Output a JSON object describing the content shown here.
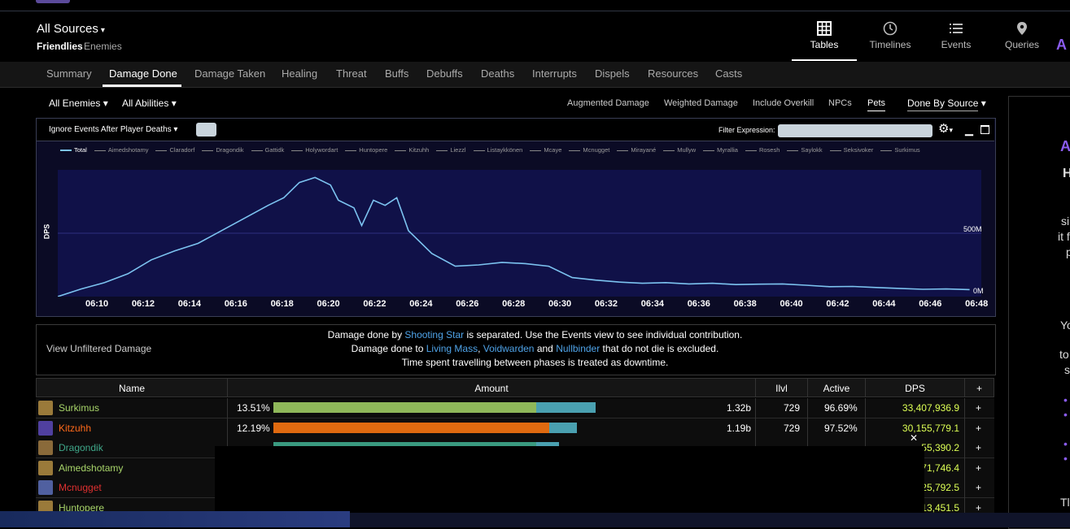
{
  "header": {
    "source_title": "All Sources",
    "friendlies": "Friendlies",
    "enemies": "Enemies",
    "nav": [
      {
        "label": "Tables",
        "icon": "table-icon"
      },
      {
        "label": "Timelines",
        "icon": "clock-icon"
      },
      {
        "label": "Events",
        "icon": "list-icon"
      },
      {
        "label": "Queries",
        "icon": "map-pin-icon"
      }
    ]
  },
  "tabs": [
    "Summary",
    "Damage Done",
    "Damage Taken",
    "Healing",
    "Threat",
    "Buffs",
    "Debuffs",
    "Deaths",
    "Interrupts",
    "Dispels",
    "Resources",
    "Casts"
  ],
  "active_tab": "Damage Done",
  "filters": {
    "enemies": "All Enemies",
    "abilities": "All Abilities",
    "options": [
      "Augmented Damage",
      "Weighted Damage",
      "Include Overkill",
      "NPCs",
      "Pets"
    ],
    "active_option": "Pets",
    "done_by": "Done By Source"
  },
  "graph": {
    "ignore_label": "Ignore Events After Player Deaths",
    "filter_label": "Filter Expression:",
    "legend": [
      "Total",
      "Aimedshotamy",
      "Claradorf",
      "Dragondik",
      "Gattidk",
      "Holywordart",
      "Huntopere",
      "Kitzuhh",
      "Liezzl",
      "Listaykkönen",
      "Mcaye",
      "Mcnugget",
      "Mirayané",
      "Mullyw",
      "Myrallia",
      "Rosesh",
      "Saylokk",
      "Seksivoker",
      "Surkimus"
    ],
    "y_label": "DPS",
    "y_ticks": [
      "500M",
      "0M"
    ],
    "x_ticks": [
      "06:10",
      "06:12",
      "06:14",
      "06:16",
      "06:18",
      "06:20",
      "06:22",
      "06:24",
      "06:26",
      "06:28",
      "06:30",
      "06:32",
      "06:34",
      "06:36",
      "06:38",
      "06:40",
      "06:42",
      "06:44",
      "06:46",
      "06:48"
    ]
  },
  "chart_data": {
    "type": "line",
    "title": "",
    "ylabel": "DPS",
    "ylim": [
      0,
      1000000000
    ],
    "series": [
      {
        "name": "Total",
        "color": "#7cc3f0",
        "x": [
          "06:09:00",
          "06:10:00",
          "06:11:00",
          "06:12:00",
          "06:13:00",
          "06:14:00",
          "06:15:00",
          "06:16:00",
          "06:17:00",
          "06:18:00",
          "06:18:40",
          "06:19:20",
          "06:20:00",
          "06:20:40",
          "06:21:00",
          "06:21:40",
          "06:22:00",
          "06:22:30",
          "06:23:00",
          "06:23:30",
          "06:24:00",
          "06:25:00",
          "06:26:00",
          "06:27:00",
          "06:28:00",
          "06:29:00",
          "06:30:00",
          "06:31:00",
          "06:32:00",
          "06:33:00",
          "06:34:00",
          "06:35:00",
          "06:36:00",
          "06:37:00",
          "06:38:00",
          "06:39:00",
          "06:40:00",
          "06:41:00",
          "06:42:00",
          "06:43:00",
          "06:44:00",
          "06:45:00",
          "06:46:00",
          "06:47:00",
          "06:48:00"
        ],
        "values": [
          0,
          60000000,
          110000000,
          180000000,
          290000000,
          360000000,
          420000000,
          520000000,
          620000000,
          720000000,
          780000000,
          900000000,
          940000000,
          880000000,
          760000000,
          700000000,
          560000000,
          760000000,
          720000000,
          780000000,
          520000000,
          340000000,
          240000000,
          250000000,
          270000000,
          260000000,
          240000000,
          150000000,
          130000000,
          115000000,
          105000000,
          110000000,
          100000000,
          105000000,
          95000000,
          98000000,
          100000000,
          90000000,
          78000000,
          80000000,
          72000000,
          65000000,
          58000000,
          60000000,
          55000000
        ]
      }
    ]
  },
  "notice": {
    "left": "View Unfiltered Damage",
    "line1_a": "Damage done by ",
    "line1_hl": "Shooting Star",
    "line1_b": " is separated. Use the Events view to see individual contribution.",
    "line2_a": "Damage done to ",
    "line2_hl1": "Living Mass",
    "line2_sep1": ", ",
    "line2_hl2": "Voidwarden",
    "line2_sep2": " and ",
    "line2_hl3": "Nullbinder",
    "line2_b": " that do not die is excluded.",
    "line3": "Time spent travelling between phases is treated as downtime."
  },
  "table": {
    "headers": [
      "Name",
      "Amount",
      "Ilvl",
      "Active",
      "DPS",
      "+"
    ],
    "rows": [
      {
        "name": "Surkimus",
        "color": "#a8d56a",
        "pct": "13.51%",
        "amount": "1.32b",
        "ilvl": "729",
        "active": "96.69%",
        "dps": "33,407,936.9",
        "bar_main": 0.8,
        "bar_pet": 0.26,
        "bar_color": "#8fb85a",
        "avatar": "#9a7a3a"
      },
      {
        "name": "Kitzuhh",
        "color": "#ff6a1a",
        "pct": "12.19%",
        "amount": "1.19b",
        "ilvl": "729",
        "active": "97.52%",
        "dps": "30,155,779.1",
        "bar_main": 0.84,
        "bar_pet": 0.12,
        "bar_color": "#e06a10",
        "avatar": "#5040a0"
      },
      {
        "name": "Dragondik",
        "color": "#3fa88a",
        "pct": "",
        "amount": "",
        "ilvl": "",
        "active": "",
        "dps": "55,390.2",
        "bar_main": 0.8,
        "bar_pet": 0.1,
        "bar_color": "#3a9a80",
        "avatar": "#8a6a3a"
      },
      {
        "name": "Aimedshotamy",
        "color": "#a8d56a",
        "pct": "",
        "amount": "",
        "ilvl": "",
        "active": "",
        "dps": "71,746.4",
        "bar_main": 0,
        "bar_pet": 0,
        "bar_color": "#8fb85a",
        "avatar": "#9a7a3a"
      },
      {
        "name": "Mcnugget",
        "color": "#e03030",
        "pct": "",
        "amount": "",
        "ilvl": "",
        "active": "",
        "dps": "25,792.5",
        "bar_main": 0,
        "bar_pet": 0,
        "bar_color": "#c03030",
        "avatar": "#5060a0"
      },
      {
        "name": "Huntopere",
        "color": "#a8d56a",
        "pct": "",
        "amount": "",
        "ilvl": "",
        "active": "",
        "dps": "13,451.5",
        "bar_main": 0,
        "bar_pet": 0,
        "bar_color": "#8fb85a",
        "avatar": "#9a7a3a"
      }
    ]
  },
  "side_panel_fragments": [
    "H",
    "si",
    "it f",
    "p",
    "Yo",
    "to",
    "s",
    "•",
    "•",
    "•",
    "•",
    "Tl"
  ]
}
